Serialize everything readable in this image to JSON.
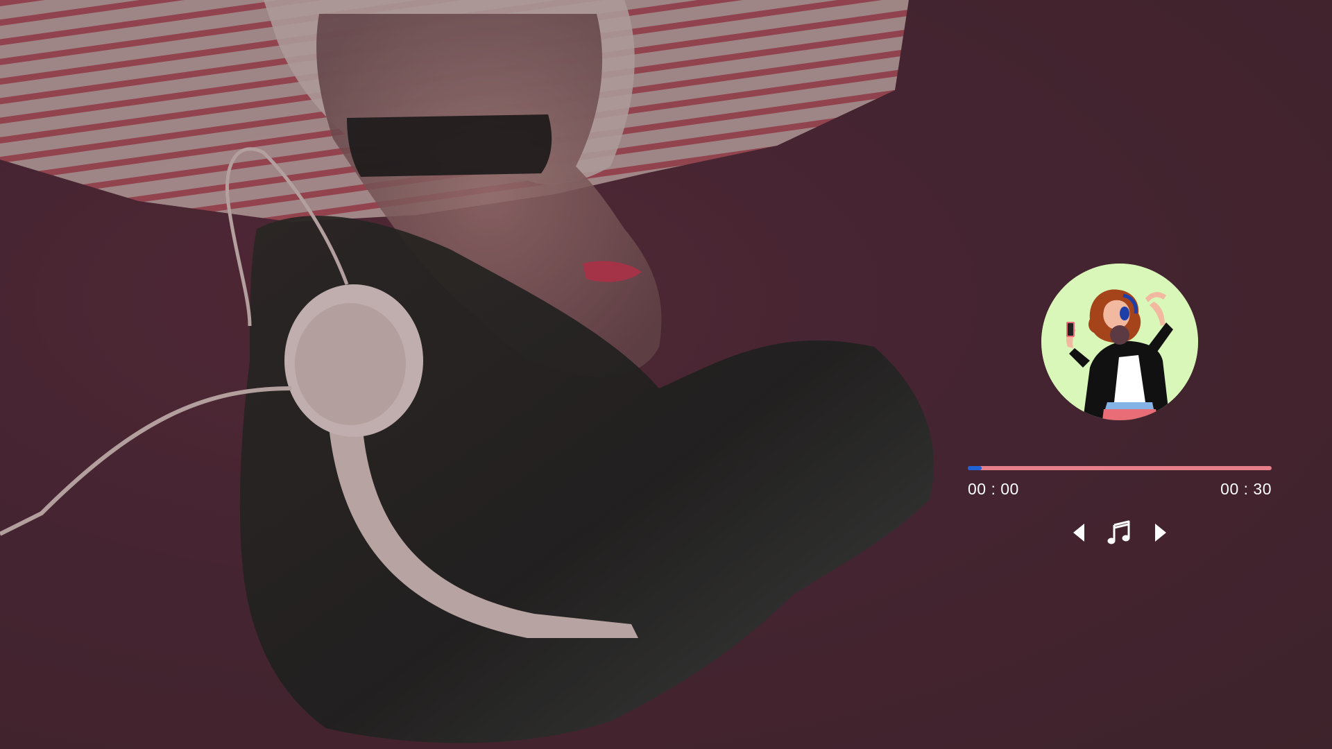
{
  "player": {
    "current_time": "00 : 00",
    "total_time": "00 : 30",
    "progress": 0.045,
    "icons": {
      "previous": "caret-left-icon",
      "play": "music-note-icon",
      "next": "caret-right-icon",
      "album": "album-art-woman-dancing-headphones"
    }
  },
  "background": {
    "icon": "woman-with-headphones-photo"
  },
  "colors": {
    "background": "#4a2a36",
    "progress_track": "#e77f8b",
    "progress_fill": "#1f63d6",
    "album_bg": "#d9f7b8",
    "text": "#ffffff"
  }
}
